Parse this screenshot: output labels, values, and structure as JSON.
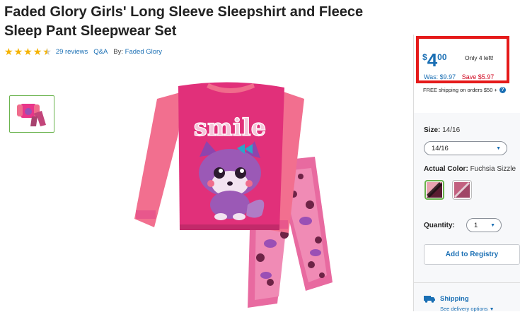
{
  "product": {
    "title": "Faded Glory Girls' Long Sleeve Sleepshirt and Fleece Sleep Pant Sleepwear Set",
    "rating": 4.5,
    "reviews_label": "29 reviews",
    "qa_label": "Q&A",
    "by_label": "By:",
    "brand": "Faded Glory",
    "shirt_graphic_text": "smile"
  },
  "pricing": {
    "currency": "$",
    "dollars": "4",
    "cents": "00",
    "stock_note": "Only 4 left!",
    "was": "Was: $9.97",
    "save": "Save $5.97",
    "shipping_note": "FREE shipping on orders $50 +"
  },
  "options": {
    "size_label": "Size:",
    "size_value": "14/16",
    "size_selected": "14/16",
    "color_label": "Actual Color:",
    "color_value": "Fuchsia Sizzle",
    "quantity_label": "Quantity:",
    "quantity_value": "1"
  },
  "actions": {
    "registry": "Add to Registry"
  },
  "shipping": {
    "label": "Shipping",
    "delivery_link": "See delivery options"
  },
  "colors": {
    "accent": "#1a6fb4",
    "highlight_box": "#e51a1a",
    "save_red": "#d0021b",
    "selected_border": "#69b34c",
    "star": "#f5b301"
  },
  "icons": [
    "star-icon",
    "chevron-down-icon",
    "help-icon",
    "truck-icon"
  ]
}
